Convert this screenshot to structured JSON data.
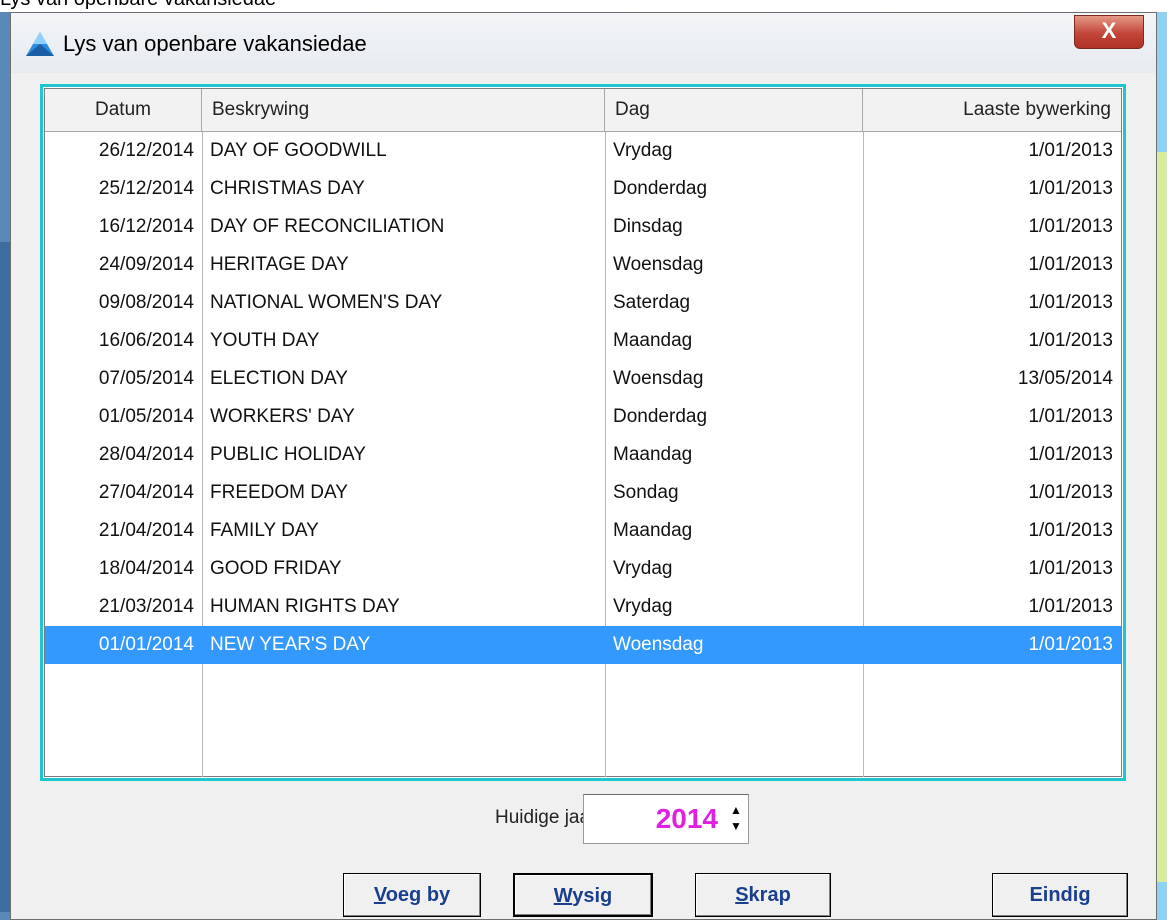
{
  "window": {
    "title": "Lys van openbare vakansiedae",
    "close_label": "X",
    "behind_title_fragment": "Lys van openbare vakansiedae"
  },
  "table": {
    "columns": [
      "Datum",
      "Beskrywing",
      "Dag",
      "Laaste bywerking"
    ],
    "rows": [
      {
        "datum": "26/12/2014",
        "beskrywing": "DAY OF GOODWILL",
        "dag": "Vrydag",
        "laaste": "1/01/2013"
      },
      {
        "datum": "25/12/2014",
        "beskrywing": "CHRISTMAS DAY",
        "dag": "Donderdag",
        "laaste": "1/01/2013"
      },
      {
        "datum": "16/12/2014",
        "beskrywing": "DAY OF RECONCILIATION",
        "dag": "Dinsdag",
        "laaste": "1/01/2013"
      },
      {
        "datum": "24/09/2014",
        "beskrywing": "HERITAGE DAY",
        "dag": "Woensdag",
        "laaste": "1/01/2013"
      },
      {
        "datum": "09/08/2014",
        "beskrywing": "NATIONAL WOMEN'S DAY",
        "dag": "Saterdag",
        "laaste": "1/01/2013"
      },
      {
        "datum": "16/06/2014",
        "beskrywing": "YOUTH DAY",
        "dag": "Maandag",
        "laaste": "1/01/2013"
      },
      {
        "datum": "07/05/2014",
        "beskrywing": "ELECTION DAY",
        "dag": "Woensdag",
        "laaste": "13/05/2014"
      },
      {
        "datum": "01/05/2014",
        "beskrywing": "WORKERS' DAY",
        "dag": "Donderdag",
        "laaste": "1/01/2013"
      },
      {
        "datum": "28/04/2014",
        "beskrywing": "PUBLIC HOLIDAY",
        "dag": "Maandag",
        "laaste": "1/01/2013"
      },
      {
        "datum": "27/04/2014",
        "beskrywing": "FREEDOM DAY",
        "dag": "Sondag",
        "laaste": "1/01/2013"
      },
      {
        "datum": "21/04/2014",
        "beskrywing": "FAMILY DAY",
        "dag": "Maandag",
        "laaste": "1/01/2013"
      },
      {
        "datum": "18/04/2014",
        "beskrywing": "GOOD FRIDAY",
        "dag": "Vrydag",
        "laaste": "1/01/2013"
      },
      {
        "datum": "21/03/2014",
        "beskrywing": "HUMAN RIGHTS DAY",
        "dag": "Vrydag",
        "laaste": "1/01/2013"
      },
      {
        "datum": "01/01/2014",
        "beskrywing": "NEW YEAR'S DAY",
        "dag": "Woensdag",
        "laaste": "1/01/2013",
        "selected": true
      }
    ]
  },
  "year": {
    "label": "Huidige jaar:",
    "value": "2014",
    "up_icon": "▲",
    "down_icon": "▼"
  },
  "buttons": {
    "add": {
      "hotkey": "V",
      "rest": "oeg by"
    },
    "edit": {
      "hotkey": "W",
      "rest": "ysig"
    },
    "delete": {
      "hotkey": "S",
      "rest": "krap"
    },
    "end": {
      "label": "Eindig"
    }
  },
  "colors": {
    "grid_border": "#1ec7cf",
    "selection": "#3399ff",
    "year_value": "#e020e0",
    "button_text": "#1b3f8f",
    "close_button": "#c2453a"
  },
  "icons": {
    "app": "app-logo-icon",
    "close": "close-icon",
    "spin": "spin-arrows-icon"
  }
}
